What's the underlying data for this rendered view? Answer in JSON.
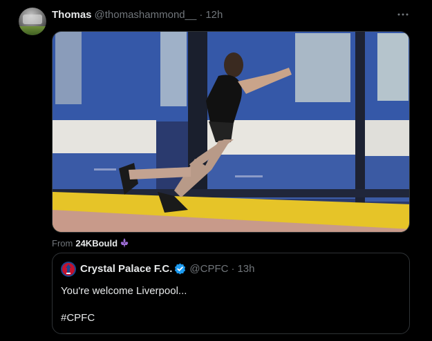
{
  "post": {
    "author_name": "Thomas",
    "author_handle": "@thomashammond__",
    "separator": "·",
    "time": "12h",
    "more_icon": "more-horizontal-icon"
  },
  "attribution": {
    "prefix": "From",
    "source": "24KBould",
    "emoji_icon": "fleur-de-lis-icon"
  },
  "quote": {
    "author_name": "Crystal Palace F.C.",
    "author_handle": "@CPFC",
    "separator": "·",
    "time": "13h",
    "text": "You're welcome Liverpool...",
    "hashtag": "#CPFC",
    "verified_icon": "verified-badge-icon"
  },
  "colors": {
    "background": "#000000",
    "text_primary": "#e7e9ea",
    "text_secondary": "#71767b",
    "border": "#2f3336",
    "verified": "#1d9bf0",
    "fleur": "#9b6bd3"
  }
}
